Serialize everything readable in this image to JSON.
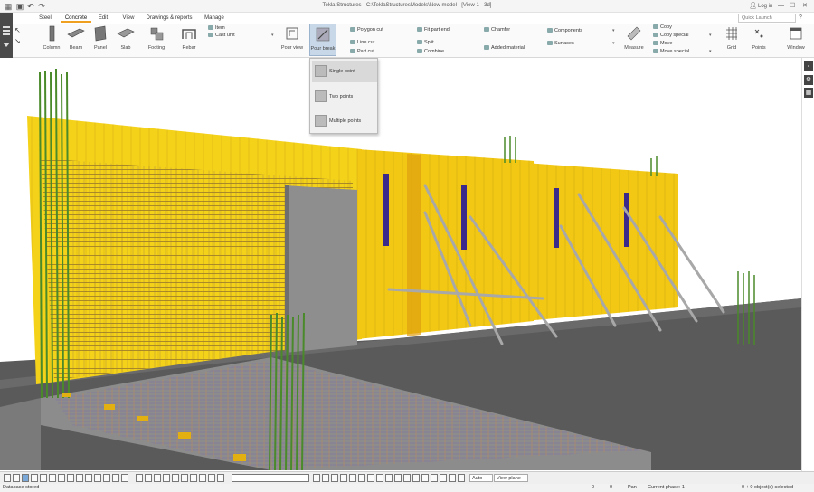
{
  "window": {
    "title": "Tekla Structures - C:\\TeklaStructuresModels\\New model - [View 1 - 3d]",
    "login_label": "Log in",
    "help_label": "?",
    "quick_launch_placeholder": "Quick Launch"
  },
  "tabs": [
    {
      "label": "Steel",
      "active": false
    },
    {
      "label": "Concrete",
      "active": true
    },
    {
      "label": "Edit",
      "active": false
    },
    {
      "label": "View",
      "active": false
    },
    {
      "label": "Drawings & reports",
      "active": false
    },
    {
      "label": "Manage",
      "active": false
    }
  ],
  "ribbon": {
    "column": "Column",
    "beam": "Beam",
    "panel": "Panel",
    "slab": "Slab",
    "footing": "Footing",
    "rebar": "Rebar",
    "item": "Item",
    "cast_unit": "Cast unit",
    "pour_view": "Pour view",
    "pour_break": "Pour break",
    "polygon_cut": "Polygon cut",
    "line_cut": "Line cut",
    "part_cut": "Part cut",
    "fit_part_end": "Fit part end",
    "split": "Split",
    "combine": "Combine",
    "chamfer": "Chamfer",
    "added_material": "Added material",
    "components": "Components",
    "surfaces": "Surfaces",
    "measure": "Measure",
    "copy": "Copy",
    "copy_special": "Copy special",
    "move": "Move",
    "move_special": "Move special",
    "grid": "Grid",
    "points": "Points",
    "window": "Window"
  },
  "pour_break_menu": [
    {
      "label": "Single point",
      "highlighted": true
    },
    {
      "label": "Two points",
      "highlighted": false
    },
    {
      "label": "Multiple points",
      "highlighted": false
    }
  ],
  "bottom_toolbar": {
    "snap_mode": "Auto",
    "plane": "View plane"
  },
  "status": {
    "message": "Database stored",
    "field1": "0",
    "field2": "0",
    "mode": "Pan",
    "phase": "Current phase: 1",
    "selection": "0 + 0 object(s) selected"
  },
  "colors": {
    "formwork_yellow": "#f5d21a",
    "rebar_green": "#4a8a2a",
    "rebar_orange": "#d88a30",
    "floor_gray": "#555555",
    "accent_tab": "#f0a020"
  }
}
